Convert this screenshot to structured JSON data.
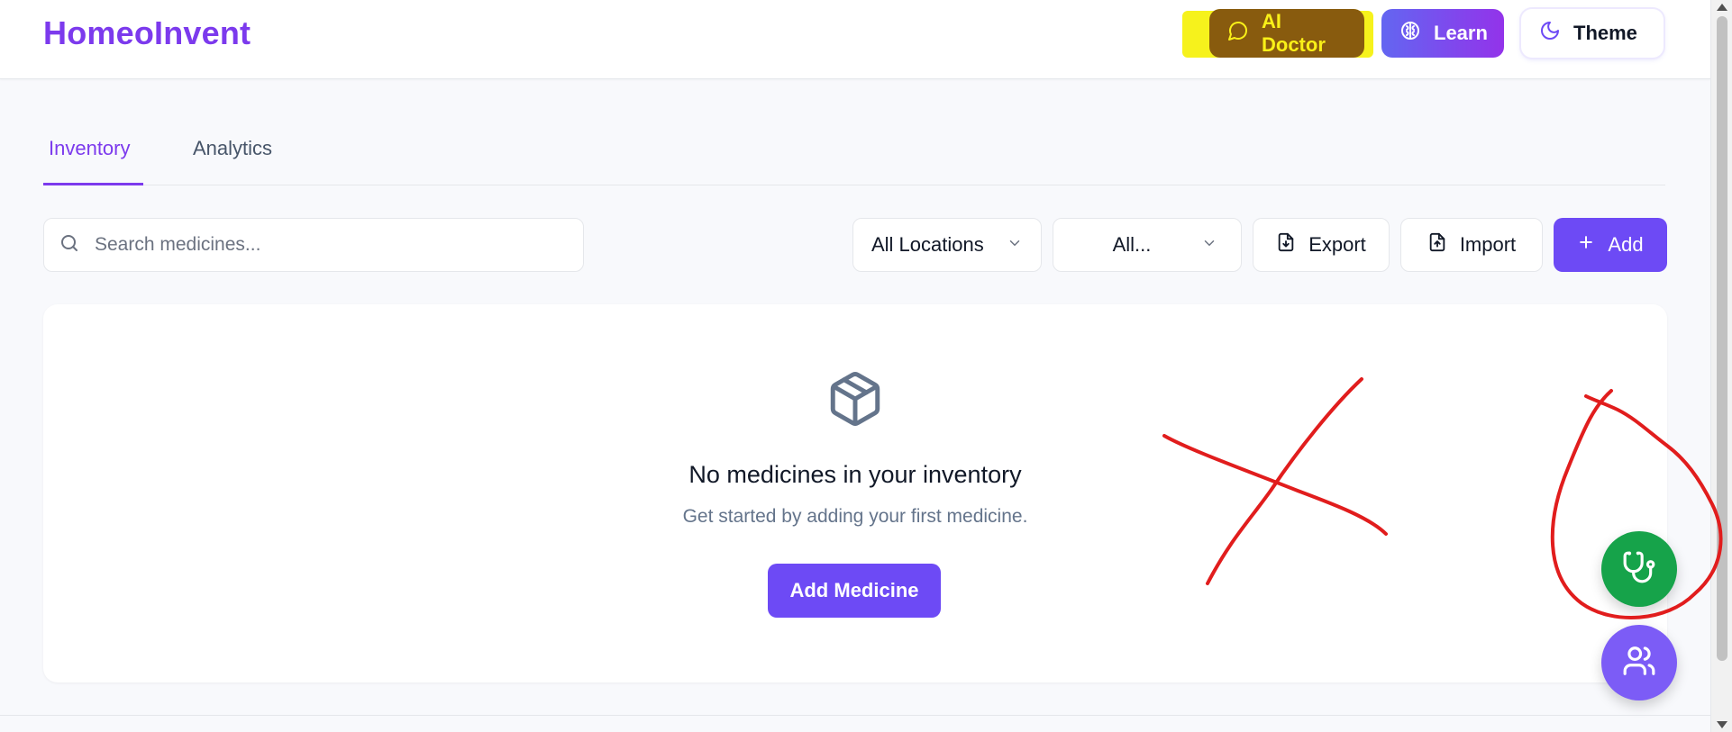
{
  "header": {
    "brand": "HomeoInvent",
    "ai_doctor_label": "AI Doctor",
    "learn_label": "Learn",
    "theme_label": "Theme"
  },
  "tabs": [
    {
      "label": "Inventory",
      "active": true
    },
    {
      "label": "Analytics",
      "active": false
    }
  ],
  "toolbar": {
    "search_placeholder": "Search medicines...",
    "location_select": "All Locations",
    "category_select": "All...",
    "export_label": "Export",
    "import_label": "Import",
    "add_label": "Add"
  },
  "empty_state": {
    "icon": "package-icon",
    "title": "No medicines in your inventory",
    "subtitle": "Get started by adding your first medicine.",
    "button_label": "Add Medicine"
  },
  "floating_buttons": [
    {
      "icon": "stethoscope-icon",
      "color": "#16a34a"
    },
    {
      "icon": "users-icon",
      "color": "#7c5cf6"
    }
  ],
  "colors": {
    "brand": "#7c3aed",
    "primary_button": "#6d4af5",
    "highlight_yellow": "#f6f21c",
    "annotation_red": "#e11d1d"
  }
}
